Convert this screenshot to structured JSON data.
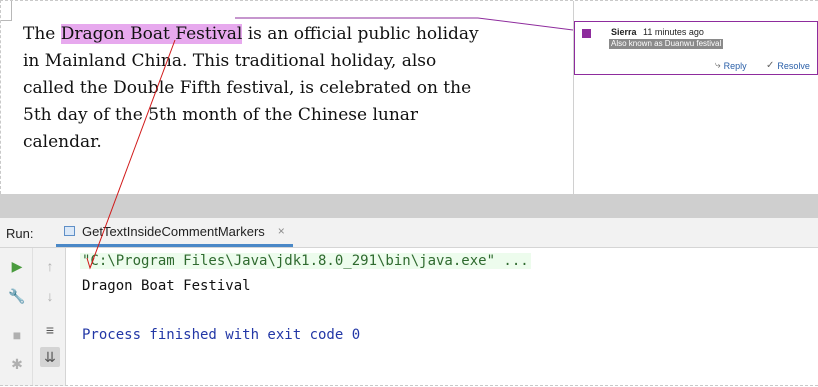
{
  "document": {
    "paragraph_before": "The ",
    "highlight": "Dragon Boat Festival",
    "paragraph_after": " is an official public holiday in Mainland China. This traditional holiday, also called the Double Fifth festival, is celebrated on the 5th day of the 5th month of the Chinese lunar calendar."
  },
  "comment": {
    "author": "Sierra",
    "time": "11 minutes ago",
    "text": "Also known as Duanwu festival",
    "reply_label": "Reply",
    "resolve_label": "Resolve",
    "accent_color": "#8e2c9d"
  },
  "run_panel": {
    "label": "Run:",
    "tab_title": "GetTextInsideCommentMarkers",
    "console": {
      "command": "\"C:\\Program Files\\Java\\jdk1.8.0_291\\bin\\java.exe\" ...",
      "output": "Dragon Boat Festival",
      "exit_message": "Process finished with exit code 0"
    }
  },
  "icons": {
    "run": "run-icon",
    "up": "arrow-up-icon",
    "wrench": "wrench-icon",
    "down": "arrow-down-icon",
    "stop": "stop-icon",
    "wrap": "soft-wrap-icon",
    "pin": "pin-icon",
    "scroll": "scroll-to-end-icon"
  }
}
